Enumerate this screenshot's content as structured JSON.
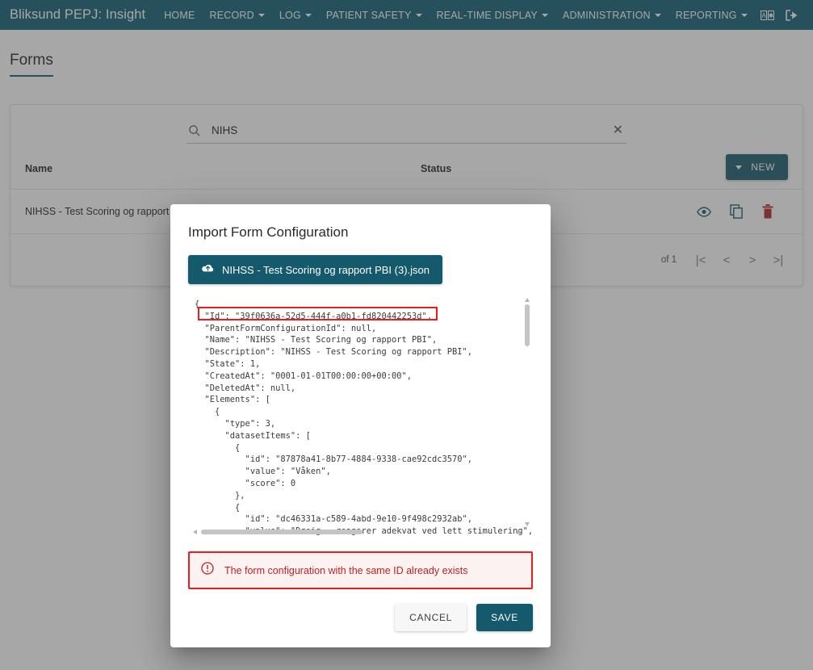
{
  "navbar": {
    "brand": "Bliksund PEPJ: Insight",
    "items": [
      {
        "label": "HOME",
        "has_caret": false
      },
      {
        "label": "RECORD",
        "has_caret": true
      },
      {
        "label": "LOG",
        "has_caret": true
      },
      {
        "label": "PATIENT SAFETY",
        "has_caret": true
      },
      {
        "label": "REAL-TIME DISPLAY",
        "has_caret": true
      },
      {
        "label": "ADMINISTRATION",
        "has_caret": true
      },
      {
        "label": "REPORTING",
        "has_caret": true
      }
    ],
    "icons": [
      {
        "name": "language-switch-icon"
      },
      {
        "name": "logout-icon"
      }
    ],
    "background": "#0d5c70"
  },
  "page": {
    "title": "Forms"
  },
  "search": {
    "value": "NIHS",
    "placeholder": "",
    "icon": "search-icon",
    "clear_icon": "close-icon"
  },
  "table": {
    "columns": [
      "Name",
      "Status"
    ],
    "new_button": "NEW",
    "rows": [
      {
        "name": "NIHSS - Test Scoring og rapport PBI",
        "status": "",
        "actions": [
          "view-icon",
          "duplicate-icon",
          "delete-icon"
        ]
      }
    ]
  },
  "pagination": {
    "label": "of 1",
    "first": "|<",
    "prev": "<",
    "next": ">",
    "last": ">|"
  },
  "modal": {
    "title": "Import Form Configuration",
    "upload_button": "NIHSS - Test Scoring og rapport PBI (3).json",
    "upload_icon": "cloud-upload-icon",
    "json_content": "{\n  \"Id\": \"39f0636a-52d5-444f-a0b1-fd820442253d\",\n  \"ParentFormConfigurationId\": null,\n  \"Name\": \"NIHSS - Test Scoring og rapport PBI\",\n  \"Description\": \"NIHSS - Test Scoring og rapport PBI\",\n  \"State\": 1,\n  \"CreatedAt\": \"0001-01-01T00:00:00+00:00\",\n  \"DeletedAt\": null,\n  \"Elements\": [\n    {\n      \"type\": 3,\n      \"datasetItems\": [\n        {\n          \"id\": \"87878a41-8b77-4884-9338-cae92cdc3570\",\n          \"value\": \"Våken\",\n          \"score\": 0\n        },\n        {\n          \"id\": \"dc46331a-c589-4abd-9e10-9f498c2932ab\",\n          \"value\": \"Døsig - reagerer adekvat ved lett stimulering\",",
    "highlighted_line": "\"Id\": \"39f0636a-52d5-444f-a0b1-fd820442253d\",",
    "error_message": "The form configuration with the same ID already exists",
    "error_icon": "alert-circle-icon",
    "cancel_button": "CANCEL",
    "save_button": "SAVE",
    "error_color": "#ef1c1c",
    "accent_color": "#15596d"
  }
}
